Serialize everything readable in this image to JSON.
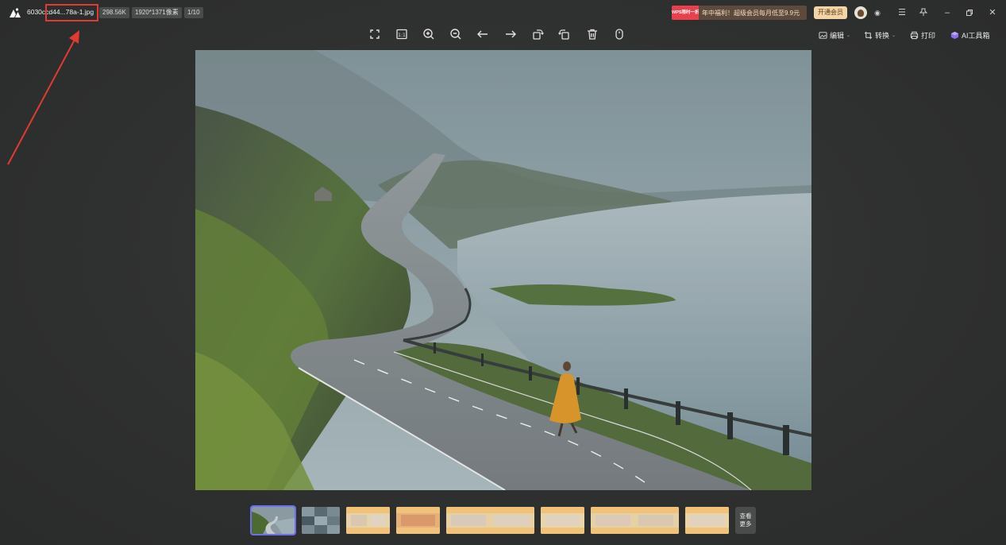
{
  "titlebar": {
    "filename": "6030ccd44...78a-1.jpg",
    "filesize": "298.56K",
    "dimensions": "1920*1371像素",
    "page_index": "1/10",
    "promo_badge": "WPS限时一折",
    "promo_text": "年中福利！超级会员每月低至9.9元",
    "vip_button": "开通会员"
  },
  "toolbar": {
    "icons": [
      "fullscreen-icon",
      "actual-size-icon",
      "zoom-in-icon",
      "zoom-out-icon",
      "previous-icon",
      "next-icon",
      "rotate-left-icon",
      "rotate-right-icon",
      "delete-icon",
      "mouse-icon"
    ],
    "right": {
      "edit": "编辑",
      "convert": "转换",
      "print": "打印",
      "ai_toolbox": "AI工具箱"
    }
  },
  "thumbnails": {
    "count": 10,
    "active_index": 0,
    "more_label_line1": "查看",
    "more_label_line2": "更多"
  },
  "colors": {
    "background": "#2f3030",
    "highlight": "#e03a32",
    "active_thumb": "#6b6ff0",
    "vip": "#f3d4a6",
    "promo_badge": "#e8404d"
  }
}
